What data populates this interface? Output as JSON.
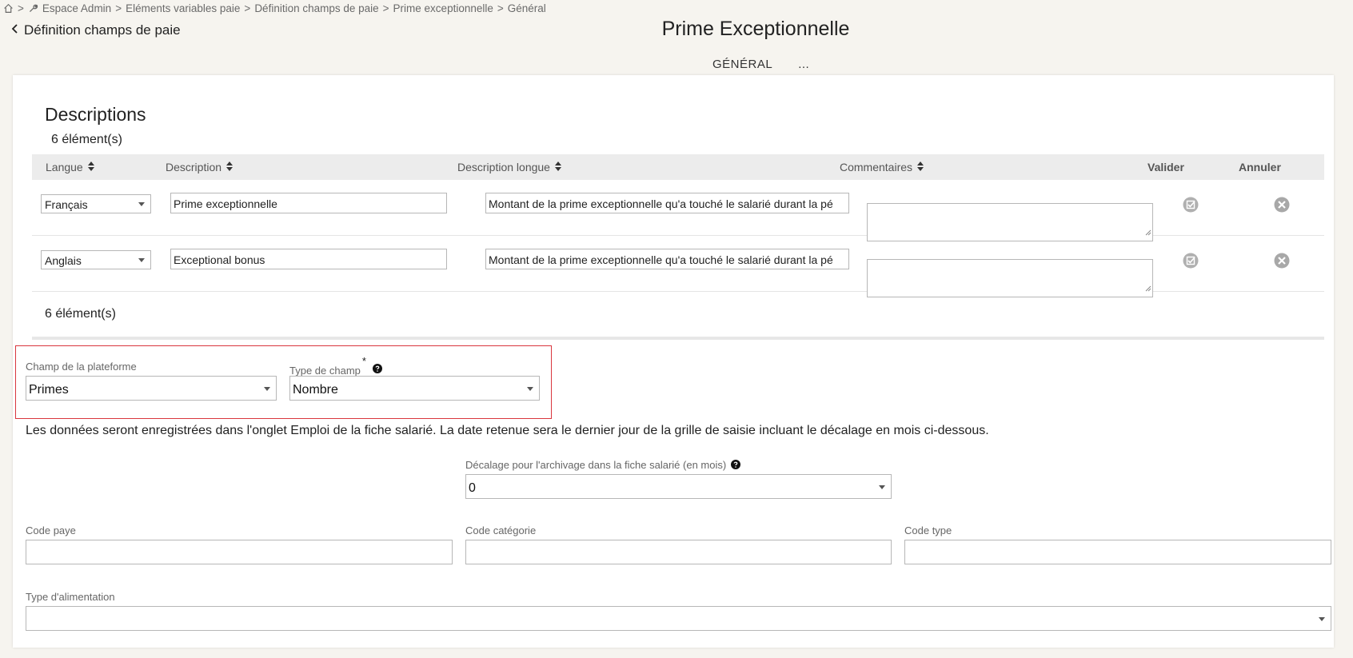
{
  "breadcrumb": {
    "items": [
      "Espace Admin",
      "Eléments variables paie",
      "Définition champs de paie",
      "Prime exceptionnelle",
      "Général"
    ],
    "separator": ">"
  },
  "header": {
    "back_label": "Définition champs de paie",
    "title": "Prime Exceptionnelle",
    "tabs": [
      {
        "label": "GÉNÉRAL",
        "active": true
      },
      {
        "label": "..."
      }
    ]
  },
  "descriptions": {
    "title": "Descriptions",
    "count_top": "6 élément(s)",
    "count_bottom": "6 élément(s)",
    "columns": {
      "langue": "Langue",
      "description": "Description",
      "description_longue": "Description longue",
      "commentaires": "Commentaires",
      "valider": "Valider",
      "annuler": "Annuler"
    },
    "rows": [
      {
        "langue": "Français",
        "description": "Prime exceptionnelle",
        "description_longue": "Montant de la prime exceptionnelle qu'a touché le salarié durant la pé",
        "commentaires": ""
      },
      {
        "langue": "Anglais",
        "description": "Exceptional bonus",
        "description_longue": "Montant de la prime exceptionnelle qu'a touché le salarié durant la pé",
        "commentaires": ""
      }
    ]
  },
  "form": {
    "champ_plateforme": {
      "label": "Champ de la plateforme",
      "value": "Primes"
    },
    "type_champ": {
      "label": "Type de champ",
      "required_mark": "*",
      "value": "Nombre"
    },
    "info_text": "Les données seront enregistrées dans l'onglet Emploi de la fiche salarié. La date retenue sera le dernier jour de la grille de saisie incluant le décalage en mois ci-dessous.",
    "decalage": {
      "label": "Décalage pour l'archivage dans la fiche salarié (en mois)",
      "value": "0"
    },
    "code_paye": {
      "label": "Code paye",
      "value": ""
    },
    "code_categorie": {
      "label": "Code catégorie",
      "value": ""
    },
    "code_type": {
      "label": "Code type",
      "value": ""
    },
    "type_alimentation": {
      "label": "Type d'alimentation",
      "value": ""
    }
  },
  "colors": {
    "accent_border": "#d9363e",
    "tab_underline": "#2f3e4a",
    "background": "#f6f4ef"
  }
}
